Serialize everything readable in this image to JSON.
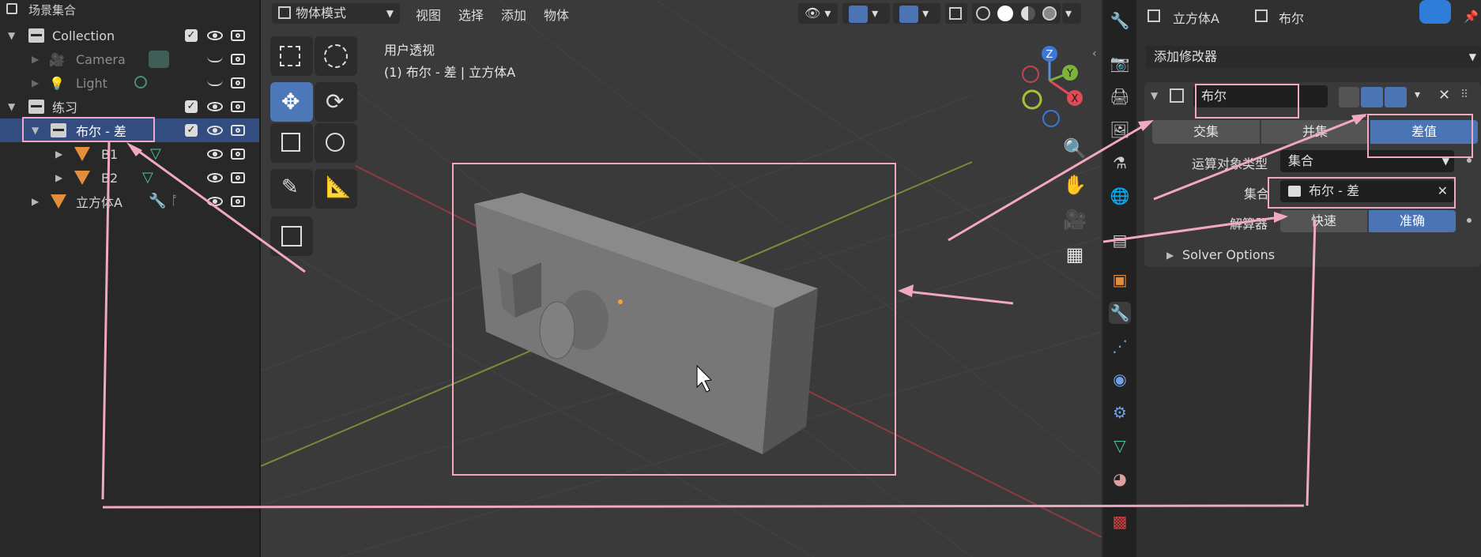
{
  "outliner": {
    "header": "场景集合",
    "rows": [
      {
        "label": "Collection"
      },
      {
        "label": "Camera"
      },
      {
        "label": "Light"
      },
      {
        "label": "练习"
      },
      {
        "label": "布尔 - 差"
      },
      {
        "label": "B1"
      },
      {
        "label": "B2"
      },
      {
        "label": "立方体A"
      }
    ]
  },
  "viewport": {
    "mode": "物体模式",
    "menus": [
      "视图",
      "选择",
      "添加",
      "物体"
    ],
    "info_line1": "用户透视",
    "info_line2": "(1) 布尔 - 差 | 立方体A",
    "gizmo": {
      "z": "Z",
      "y": "Y",
      "x": "X"
    }
  },
  "props": {
    "breadcrumb_object": "立方体A",
    "breadcrumb_modifier": "布尔",
    "add_modifier": "添加修改器",
    "modifier_name": "布尔",
    "operations": [
      "交集",
      "并集",
      "差值"
    ],
    "active_operation": "差值",
    "operand_type_label": "运算对象类型",
    "operand_type_value": "集合",
    "collection_label": "集合",
    "collection_value": "布尔 - 差",
    "solver_label": "解算器",
    "solvers": [
      "快速",
      "准确"
    ],
    "active_solver": "准确",
    "solver_options": "Solver Options"
  }
}
